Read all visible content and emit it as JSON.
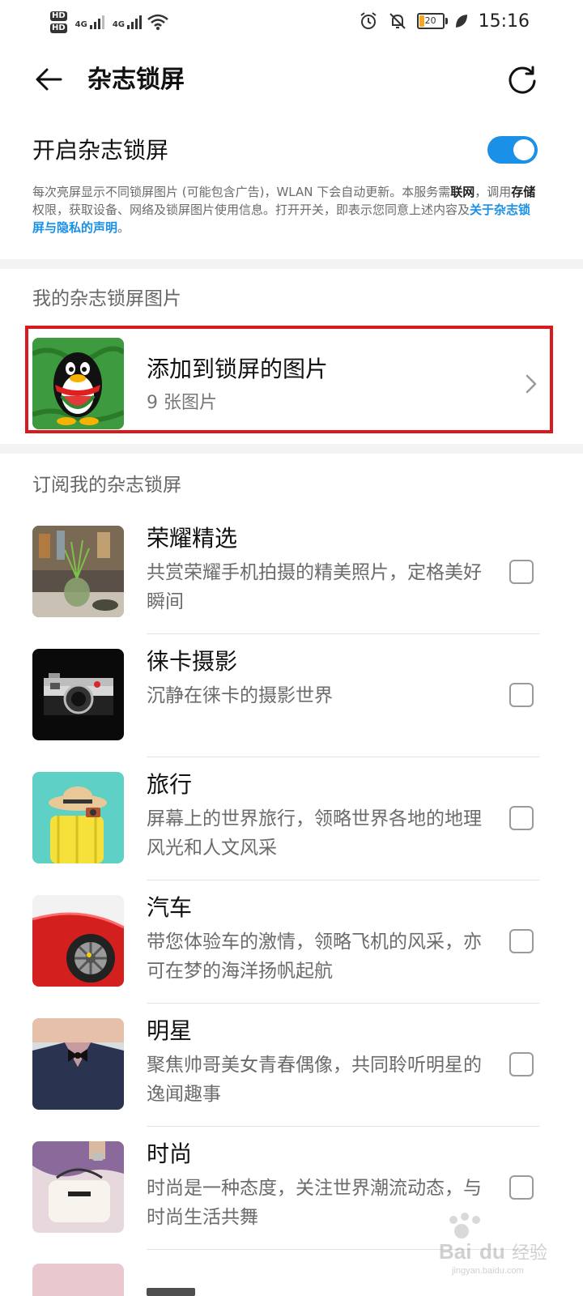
{
  "status_bar": {
    "hd1": "HD",
    "hd2": "HD",
    "net1": "4G",
    "net2": "4G",
    "battery": "20",
    "time": "15:16"
  },
  "header": {
    "title": "杂志锁屏"
  },
  "toggle": {
    "label": "开启杂志锁屏",
    "on": true
  },
  "description": {
    "part1": "每次亮屏显示不同锁屏图片 (可能包含广告)，WLAN 下会自动更新。本服务需",
    "bold1": "联网",
    "part2": "，调用",
    "bold2": "存储",
    "part3": "权限，获取设备、网络及锁屏图片使用信息。打开开关，即表示您同意上述内容及",
    "link": "关于杂志锁屏与隐私的声明",
    "part4": "。"
  },
  "my_pictures": {
    "section_title": "我的杂志锁屏图片",
    "title": "添加到锁屏的图片",
    "count": "9 张图片"
  },
  "subscriptions": {
    "section_title": "订阅我的杂志锁屏",
    "items": [
      {
        "title": "荣耀精选",
        "desc": "共赏荣耀手机拍摄的精美照片，定格美好瞬间",
        "checked": false
      },
      {
        "title": "徕卡摄影",
        "desc": "沉静在徕卡的摄影世界",
        "checked": false
      },
      {
        "title": "旅行",
        "desc": "屏幕上的世界旅行，领略世界各地的地理风光和人文风采",
        "checked": false
      },
      {
        "title": "汽车",
        "desc": "带您体验车的激情，领略飞机的风采，亦可在梦的海洋扬帆起航",
        "checked": false
      },
      {
        "title": "明星",
        "desc": "聚焦帅哥美女青春偶像，共同聆听明星的逸闻趣事",
        "checked": false
      },
      {
        "title": "时尚",
        "desc": "时尚是一种态度，关注世界潮流动态，与时尚生活共舞",
        "checked": false
      }
    ]
  },
  "watermark": {
    "text": "Baidu经验",
    "url": "jingyan.baidu.com"
  },
  "colors": {
    "accent": "#1a90e6",
    "highlight_border": "#d71920"
  }
}
